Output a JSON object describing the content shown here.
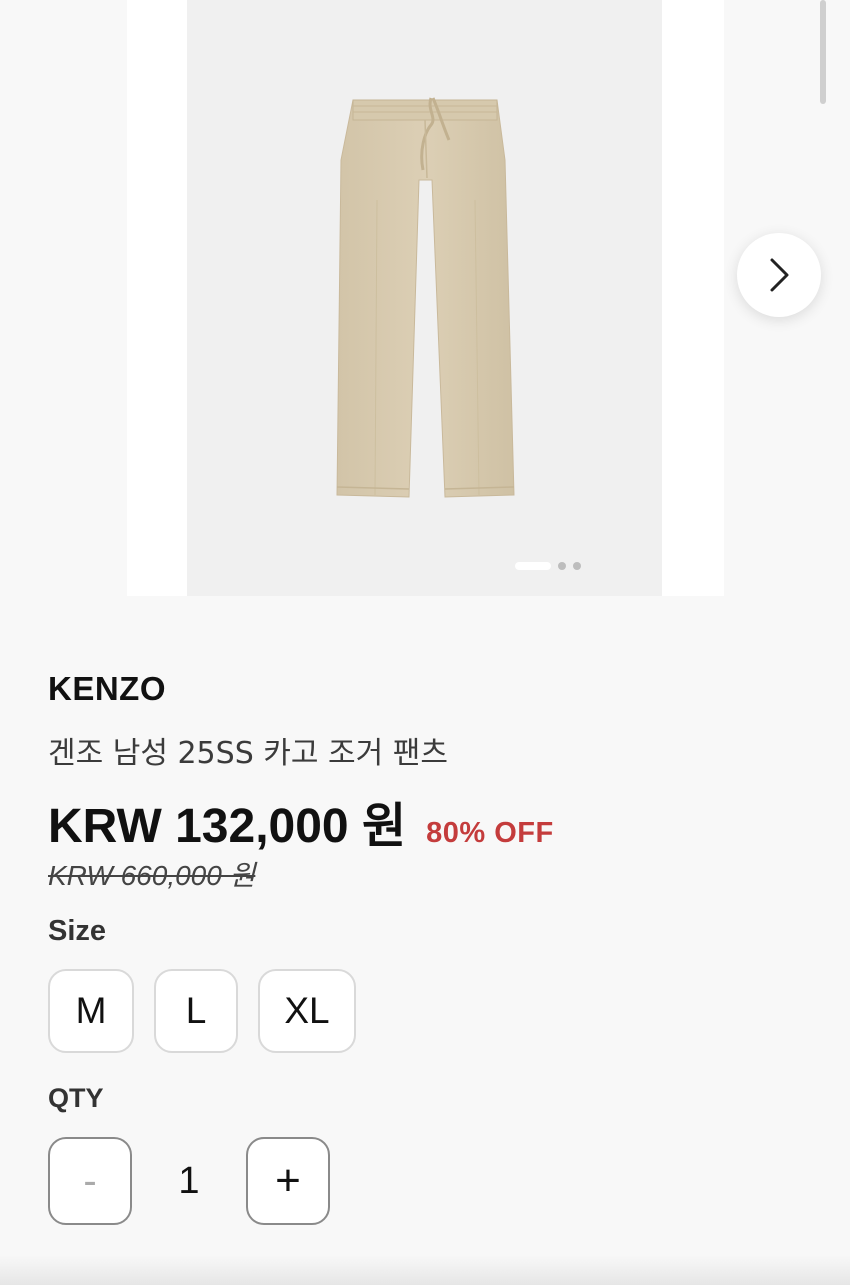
{
  "carousel": {
    "slide_count": 3,
    "active_slide": 1,
    "image_subject": "beige drawstring jogger pants",
    "next_icon": "chevron-right-icon"
  },
  "product": {
    "brand": "KENZO",
    "name": "겐조 남성 25SS 카고 조거 팬츠",
    "price": "KRW 132,000 원",
    "discount": "80% OFF",
    "original_price": "KRW 660,000 원"
  },
  "size": {
    "label": "Size",
    "options": [
      "M",
      "L",
      "XL"
    ]
  },
  "quantity": {
    "label": "QTY",
    "minus_label": "-",
    "value": "1",
    "plus_label": "+"
  },
  "colors": {
    "background": "#f8f8f8",
    "discount": "#c43c3c",
    "product": "#d8cbb0"
  }
}
